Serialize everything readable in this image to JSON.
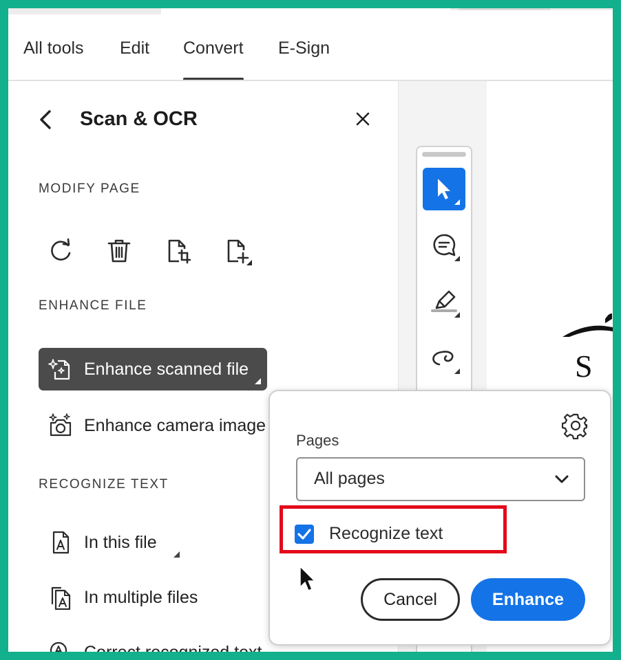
{
  "tabs": [
    {
      "label": "All tools"
    },
    {
      "label": "Edit"
    },
    {
      "label": "Convert",
      "active": true
    },
    {
      "label": "E-Sign"
    }
  ],
  "panel": {
    "title": "Scan & OCR",
    "sections": {
      "modify_page": "MODIFY PAGE",
      "enhance_file": "ENHANCE FILE",
      "recognize_text": "RECOGNIZE TEXT"
    },
    "modify_icons": [
      "rotate-icon",
      "delete-icon",
      "crop-page-icon",
      "insert-page-icon"
    ],
    "enhance_items": [
      {
        "label": "Enhance scanned file",
        "selected": true,
        "icon": "sparkle-document-icon"
      },
      {
        "label": "Enhance camera image",
        "icon": "sparkle-camera-icon"
      }
    ],
    "recognize_items": [
      {
        "label": "In this file",
        "icon": "text-document-icon"
      },
      {
        "label": "In multiple files",
        "icon": "multiple-documents-icon"
      },
      {
        "label": "Correct recognized text",
        "icon": "magnify-text-icon"
      }
    ]
  },
  "toolbar": {
    "tools": [
      "select-cursor-icon",
      "add-comment-icon",
      "highlight-icon",
      "draw-freehand-icon"
    ]
  },
  "document": {
    "visible_text": "S A"
  },
  "popover": {
    "pages_label": "Pages",
    "pages_value": "All pages",
    "recognize_text_label": "Recognize text",
    "recognize_text_checked": true,
    "cancel_label": "Cancel",
    "enhance_label": "Enhance"
  },
  "colors": {
    "accent": "#1473e6",
    "selected_bg": "#4b4b4b",
    "highlight": "#e3091b",
    "frame_border": "#12b08c"
  }
}
